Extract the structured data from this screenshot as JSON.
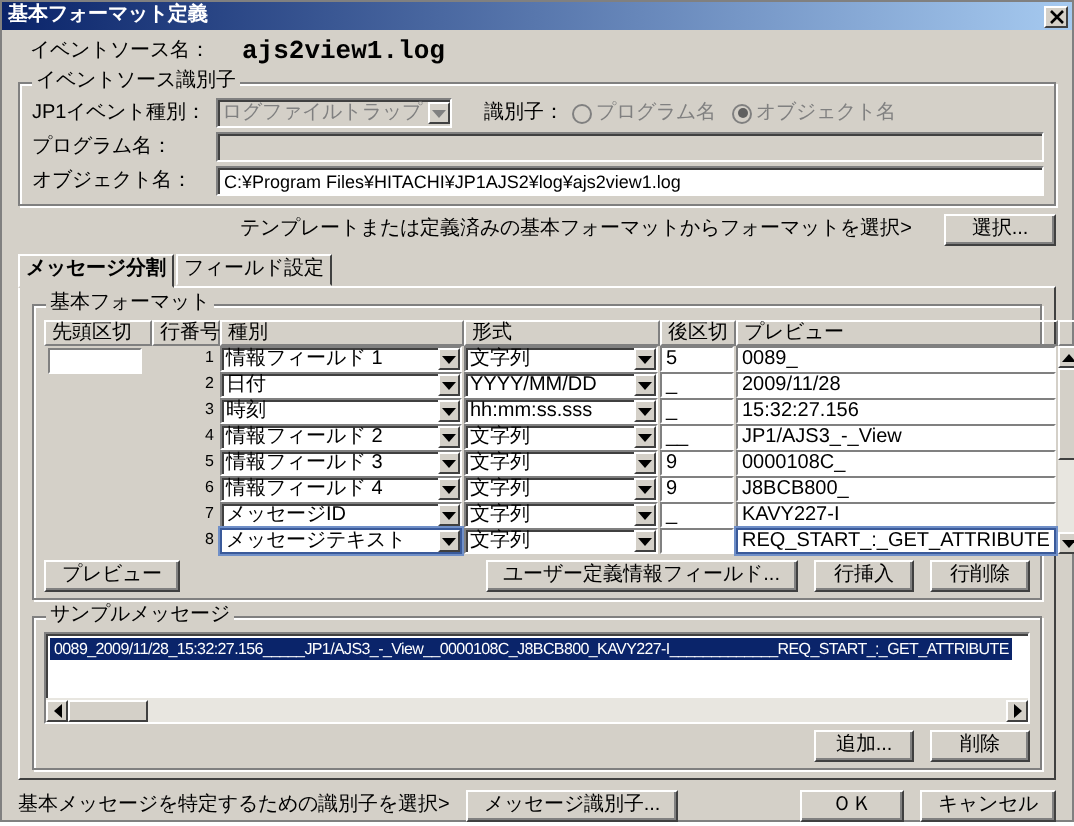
{
  "window": {
    "title": "基本フォーマット定義"
  },
  "event_source": {
    "label": "イベントソース名：",
    "value": "ajs2view1.log"
  },
  "identifier_group": {
    "title": "イベントソース識別子",
    "event_type": {
      "label": "JP1イベント種別：",
      "value": "ログファイルトラップ",
      "disabled": true
    },
    "identifier": {
      "label": "識別子：",
      "options": [
        {
          "label": "プログラム名",
          "selected": false,
          "disabled": true
        },
        {
          "label": "オブジェクト名",
          "selected": true,
          "disabled": true
        }
      ]
    },
    "program": {
      "label": "プログラム名：",
      "disabled": true
    },
    "object": {
      "label": "オブジェクト名：",
      "value": "C:¥Program Files¥HITACHI¥JP1AJS2¥log¥ajs2view1.log"
    }
  },
  "template": {
    "hint": "テンプレートまたは定義済みの基本フォーマットからフォーマットを選択>",
    "button": "選択..."
  },
  "tabs": [
    {
      "label": "メッセージ分割",
      "selected": true
    },
    {
      "label": "フィールド設定",
      "selected": false
    }
  ],
  "format_group": {
    "title": "基本フォーマット",
    "columns": [
      "先頭区切",
      "行番号",
      "種別",
      "形式",
      "後区切",
      "プレビュー"
    ],
    "rows": [
      {
        "no": "1",
        "type": "情報フィールド 1",
        "format": "文字列",
        "delimiter": "5",
        "preview": "0089_",
        "selected": false
      },
      {
        "no": "2",
        "type": "日付",
        "format": "YYYY/MM/DD",
        "delimiter": "_",
        "preview": "2009/11/28",
        "selected": false
      },
      {
        "no": "3",
        "type": "時刻",
        "format": "hh:mm:ss.sss",
        "delimiter": "_",
        "preview": "15:32:27.156",
        "selected": false
      },
      {
        "no": "4",
        "type": "情報フィールド 2",
        "format": "文字列",
        "delimiter": "__",
        "preview": "JP1/AJS3_-_View",
        "selected": false
      },
      {
        "no": "5",
        "type": "情報フィールド 3",
        "format": "文字列",
        "delimiter": "9",
        "preview": "0000108C_",
        "selected": false
      },
      {
        "no": "6",
        "type": "情報フィールド 4",
        "format": "文字列",
        "delimiter": "9",
        "preview": "J8BCB800_",
        "selected": false
      },
      {
        "no": "7",
        "type": "メッセージID",
        "format": "文字列",
        "delimiter": "_",
        "preview": "KAVY227-I",
        "selected": false
      },
      {
        "no": "8",
        "type": "メッセージテキスト",
        "format": "文字列",
        "preview": "REQ_START_:_GET_ATTRIBUTE",
        "selected": true
      }
    ],
    "buttons": {
      "preview": "プレビュー",
      "user_field": "ユーザー定義情報フィールド...",
      "insert": "行挿入",
      "delete": "行削除"
    }
  },
  "sample_group": {
    "title": "サンプルメッセージ",
    "messages": [
      {
        "text": "0089_2009/11/28_15:32:27.156_____JP1/AJS3_-_View__0000108C_J8BCB800_KAVY227-I_____________REQ_START_:_GET_ATTRIBUTE",
        "selected": true
      }
    ],
    "buttons": [
      "追加...",
      "削除"
    ]
  },
  "footer": {
    "hint": "基本メッセージを特定するための識別子を選択>",
    "identifier_button": "メッセージ識別子...",
    "ok": "ＯＫ",
    "cancel": "キャンセル"
  }
}
